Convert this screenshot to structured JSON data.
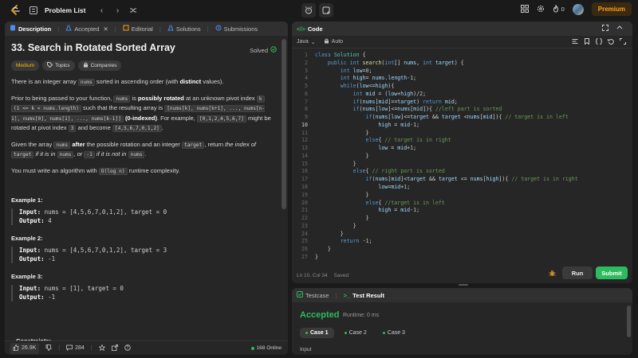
{
  "nav": {
    "title": "Problem List",
    "streak": "0",
    "premium": "Premium"
  },
  "desc_tabs": [
    "Description",
    "Accepted",
    "Editorial",
    "Solutions",
    "Submissions"
  ],
  "problem": {
    "title": "33. Search in Rotated Sorted Array",
    "status": "Solved",
    "difficulty": "Medium",
    "tag_topics": "Topics",
    "tag_companies": "Companies",
    "p1": {
      "a": "There is an integer array ",
      "code1": "nums",
      "b": " sorted in ascending order (with ",
      "bold": "distinct",
      "c": " values)."
    },
    "p2": {
      "a": "Prior to being passed to your function, ",
      "code1": "nums",
      "b": " is ",
      "bold1": "possibly rotated",
      "c": " at an unknown pivot index ",
      "code2": "k",
      "code3": "(1 <= k < nums.length)",
      "d": " such that the resulting array is ",
      "code4": "[nums[k], nums[k+1], ..., nums[n-1], nums[0], nums[1], ..., nums[k-1]]",
      "bold2": "(0-indexed)",
      "e": ". For example, ",
      "code5": "[0,1,2,4,5,6,7]",
      "f": " might be rotated at pivot index ",
      "code6": "3",
      "g": " and become ",
      "code7": "[4,5,6,7,0,1,2]",
      "h": "."
    },
    "p3": {
      "a": "Given the array ",
      "code1": "nums",
      "bold": "after",
      "b": " the possible rotation and an integer ",
      "code2": "target",
      "c": ", return ",
      "i1": "the index of ",
      "code3": "target",
      "i2": " if it is in ",
      "code4": "nums",
      "i3": ", or ",
      "code5": "-1",
      "i4": " if it is not in ",
      "code6": "nums",
      "d": "."
    },
    "p4": {
      "a": "You must write an algorithm with ",
      "code1": "O(log n)",
      "b": " runtime complexity."
    },
    "examples": [
      {
        "title": "Example 1:",
        "input": "nums = [4,5,6,7,0,1,2], target = 0",
        "output": "4"
      },
      {
        "title": "Example 2:",
        "input": "nums = [4,5,6,7,0,1,2], target = 3",
        "output": "-1"
      },
      {
        "title": "Example 3:",
        "input": "nums = [1], target = 0",
        "output": "-1"
      }
    ],
    "input_label": "Input:",
    "output_label": "Output:",
    "constraints": "Constraints:"
  },
  "footer": {
    "likes": "26.9K",
    "comments": "284",
    "online": "168 Online"
  },
  "code": {
    "tab": "Code",
    "language": "Java",
    "mode": "Auto",
    "status_pos": "Ln 10, Col 34",
    "status_saved": "Saved",
    "run": "Run",
    "submit": "Submit",
    "current_line": 10
  },
  "result": {
    "tab_testcase": "Testcase",
    "tab_result": "Test Result",
    "verdict": "Accepted",
    "runtime": "Runtime: 0 ms",
    "cases": [
      "Case 1",
      "Case 2",
      "Case 3"
    ],
    "input_label": "Input"
  },
  "colors": {
    "accent_green": "#2cbb5d",
    "premium": "#ffa116",
    "medium": "#ffb800"
  }
}
